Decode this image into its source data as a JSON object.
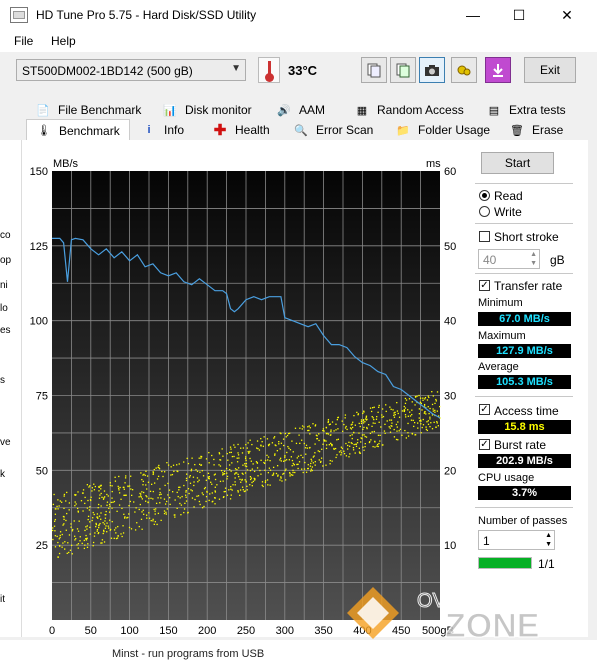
{
  "window": {
    "title": "HD Tune Pro 5.75 - Hard Disk/SSD Utility",
    "controls": {
      "minimize": "—",
      "maximize": "☐",
      "close": "✕"
    }
  },
  "menu": {
    "items": [
      "File",
      "Help"
    ]
  },
  "toolbar": {
    "drive": "ST500DM002-1BD142 (500 gB)",
    "temperature": "33°C",
    "exit_label": "Exit",
    "icons": [
      "copy-info-icon",
      "copy-text-icon",
      "camera-icon",
      "options-icon",
      "save-icon"
    ]
  },
  "tabs": {
    "row1": [
      "File Benchmark",
      "Disk monitor",
      "AAM",
      "Random Access",
      "Extra tests"
    ],
    "row2": [
      "Benchmark",
      "Info",
      "Health",
      "Error Scan",
      "Folder Usage",
      "Erase"
    ],
    "active": "Benchmark"
  },
  "controls": {
    "start_label": "Start",
    "read_label": "Read",
    "write_label": "Write",
    "mode": "Read",
    "short_stroke_label": "Short stroke",
    "short_stroke_checked": false,
    "short_stroke_value": "40",
    "short_stroke_unit": "gB",
    "transfer_rate_label": "Transfer rate",
    "transfer_rate_checked": true,
    "minimum_label": "Minimum",
    "minimum_value": "67.0 MB/s",
    "maximum_label": "Maximum",
    "maximum_value": "127.9 MB/s",
    "average_label": "Average",
    "average_value": "105.3 MB/s",
    "access_time_label": "Access time",
    "access_time_checked": true,
    "access_time_value": "15.8 ms",
    "burst_rate_label": "Burst rate",
    "burst_rate_checked": true,
    "burst_rate_value": "202.9 MB/s",
    "cpu_usage_label": "CPU usage",
    "cpu_usage_value": "3.7%",
    "passes_label": "Number of passes",
    "passes_value": "1",
    "progress_text": "1/1",
    "progress_fraction": 1.0
  },
  "chart_data": {
    "type": "line",
    "left_axis_unit": "MB/s",
    "right_axis_unit": "ms",
    "y_left_ticks": [
      150,
      125,
      100,
      75,
      50,
      25
    ],
    "y_right_ticks": [
      60,
      50,
      40,
      30,
      20,
      10
    ],
    "x_ticks": [
      "0",
      "50",
      "100",
      "150",
      "200",
      "250",
      "300",
      "350",
      "400",
      "450",
      "500gB"
    ],
    "xlim": [
      0,
      500
    ],
    "ylim_left": [
      0,
      150
    ],
    "ylim_right": [
      0,
      60
    ],
    "grid": true,
    "series": [
      {
        "color": "#4a9fe0",
        "x": [
          0,
          10,
          15,
          20,
          25,
          30,
          40,
          50,
          60,
          70,
          80,
          90,
          100,
          110,
          120,
          130,
          140,
          150,
          160,
          170,
          180,
          190,
          200,
          210,
          220,
          225,
          230,
          235,
          240,
          250,
          260,
          270,
          280,
          295,
          300,
          310,
          320,
          330,
          340,
          350,
          360,
          370,
          380,
          390,
          400,
          410,
          420,
          430,
          440,
          450,
          460,
          470,
          480,
          490,
          500
        ],
        "y": [
          127.5,
          127.5,
          126,
          113,
          127,
          127.5,
          127,
          124,
          122,
          124,
          121,
          123,
          120,
          122,
          118,
          119,
          116,
          115,
          116,
          113,
          112,
          114,
          112,
          110,
          110,
          109,
          104,
          103,
          104,
          107,
          108,
          107,
          108,
          108,
          101,
          100,
          99,
          98,
          99,
          95,
          92,
          92,
          91,
          88,
          86,
          85,
          83,
          82,
          78,
          77,
          75,
          73,
          71,
          69,
          67.5
        ]
      },
      {
        "color": "#ffff00",
        "type": "scatter",
        "trend_x": [
          0,
          500
        ],
        "trend_ms_min": [
          8,
          26
        ],
        "trend_ms_max": [
          17,
          31
        ]
      }
    ]
  },
  "background_text": {
    "left_fragments": [
      "co",
      "op",
      "ni",
      "lo",
      "es",
      "s",
      "ve",
      "k",
      "it"
    ],
    "bottom": "Minst - run programs from USB"
  },
  "watermark": {
    "line1": "OVERCLOCK",
    "line2": "ZONE"
  }
}
